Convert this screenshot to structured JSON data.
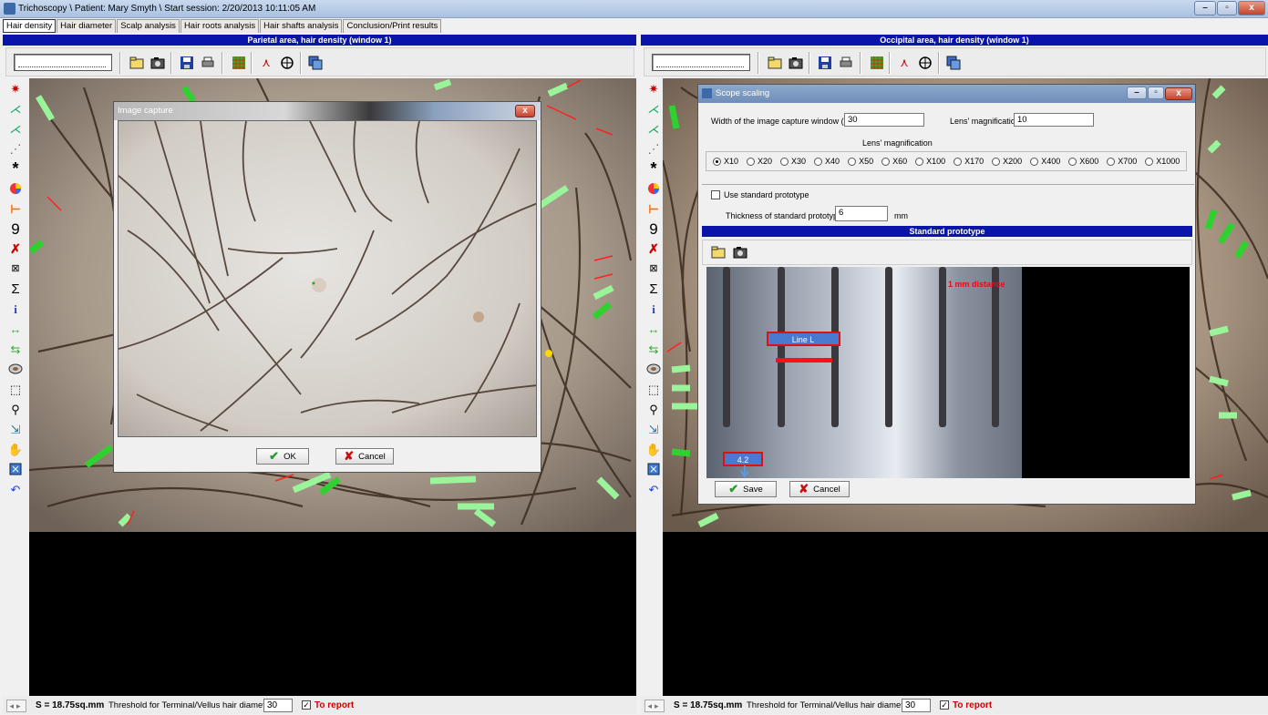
{
  "window": {
    "title": "Trichoscopy \\ Patient: Mary Smyth \\ Start session: 2/20/2013 10:11:05 AM",
    "controls": {
      "minimize": "–",
      "maximize": "▫",
      "close": "x"
    }
  },
  "tabs": [
    {
      "label": "Hair density",
      "active": true
    },
    {
      "label": "Hair diameter",
      "active": false
    },
    {
      "label": "Scalp analysis",
      "active": false
    },
    {
      "label": "Hair roots analysis",
      "active": false
    },
    {
      "label": "Hair shafts analysis",
      "active": false
    },
    {
      "label": "Conclusion/Print results",
      "active": false
    }
  ],
  "left_panel": {
    "header": "Parietal area, hair density (window 1)",
    "status": {
      "area": "S = 18.75sq.mm",
      "threshold_label": "Threshold for Terminal/Vellus hair diameter, µm:",
      "threshold_value": "30",
      "to_report_checked": true,
      "to_report_label": "To report"
    }
  },
  "right_panel": {
    "header": "Occipital area, hair density (window 1)",
    "status": {
      "area": "S = 18.75sq.mm",
      "threshold_label": "Threshold for Terminal/Vellus hair diameter, µm:",
      "threshold_value": "30",
      "to_report_checked": true,
      "to_report_label": "To report"
    }
  },
  "image_capture_dialog": {
    "title": "Image capture",
    "close": "x",
    "ok_label": "OK",
    "cancel_label": "Cancel"
  },
  "scope_scaling_dialog": {
    "title": "Scope scaling",
    "width_label": "Width of the image capture window (mm)",
    "width_value": "30",
    "lens_mag_label": "Lens' magnification",
    "lens_mag_value": "10",
    "lens_group_label": "Lens' magnification",
    "magnifications": [
      "X10",
      "X20",
      "X30",
      "X40",
      "X50",
      "X60",
      "X100",
      "X170",
      "X200",
      "X400",
      "X600",
      "X700",
      "X1000"
    ],
    "selected_magnification": "X10",
    "use_standard_label": "Use standard prototype",
    "use_standard_checked": false,
    "thickness_label": "Thickness of standard prototype:",
    "thickness_value": "6",
    "thickness_unit": "mm",
    "prototype_header": "Standard prototype",
    "overlay_line_label": "Line L",
    "overlay_mm_label": "1 mm distance",
    "overlay_value": "4.2",
    "save_label": "Save",
    "cancel_label": "Cancel"
  },
  "colors": {
    "header_blue": "#0a14a8",
    "report_red": "#d00000",
    "marker_green": "#2ed12e",
    "marker_light_green": "#9af59a",
    "marker_red": "#ff2020"
  },
  "icons": {
    "toolbar": [
      "open-folder-icon",
      "camera-icon",
      "save-disk-icon",
      "print-icon",
      "grid-icon",
      "compass-icon",
      "crosshair-icon",
      "copy-icon"
    ],
    "side": [
      "magic-wand-icon",
      "magic-wand-icon",
      "magic-wand-icon",
      "magic-wand-select-icon",
      "asterisk-icon",
      "color-wheel-icon",
      "ruler-icon",
      "number-nine-icon",
      "delete-icon",
      "delete-selection-icon",
      "sum-icon",
      "info-icon",
      "move-arrows-icon",
      "swap-arrows-icon",
      "oval-icon",
      "select-rect-icon",
      "zoom-icon",
      "export-icon",
      "hand-icon",
      "fit-icon",
      "undo-icon"
    ]
  }
}
